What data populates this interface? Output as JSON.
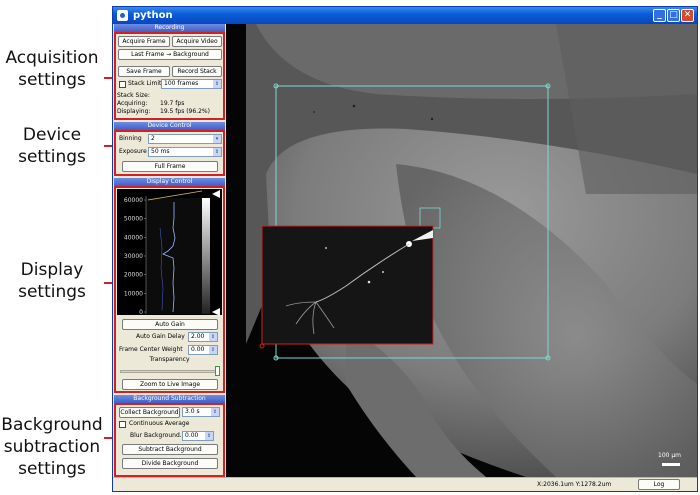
{
  "annotations": {
    "acquisition": "Acquisition settings",
    "device": "Device settings",
    "display": "Display settings",
    "background": "Background subtraction settings"
  },
  "window": {
    "title": "python"
  },
  "recording": {
    "title": "Recording",
    "acquire_frame": "Acquire Frame",
    "acquire_video": "Acquire Video",
    "last_frame_bg": "Last Frame → Background",
    "save_frame": "Save Frame",
    "record_stack": "Record Stack",
    "stack_limit_label": "Stack Limit",
    "stack_limit_value": "100 frames",
    "stack_size_label": "Stack Size:",
    "acquiring_label": "Acquiring:",
    "acquiring_value": "19.7 fps",
    "displaying_label": "Displaying:",
    "displaying_value": "19.5 fps   (96.2%)"
  },
  "device": {
    "title": "Device Control",
    "binning_label": "Binning",
    "binning_value": "2",
    "exposure_label": "Exposure",
    "exposure_value": "50 ms",
    "full_frame": "Full Frame"
  },
  "display": {
    "title": "Display Control",
    "histogram_ticks": [
      "60000",
      "50000",
      "40000",
      "30000",
      "20000",
      "10000",
      "0"
    ],
    "auto_gain": "Auto Gain",
    "auto_gain_delay_label": "Auto Gain Delay",
    "auto_gain_delay_value": "2.00",
    "frame_center_weight_label": "Frame Center Weight",
    "frame_center_weight_value": "0.00",
    "transparency_label": "Transparency",
    "zoom_live": "Zoom to Live Image"
  },
  "background": {
    "title": "Background Subtraction",
    "collect": "Collect Background",
    "collect_value": "3.0 s",
    "continuous_avg": "Continuous Average",
    "blur_label": "Blur Background.",
    "blur_value": "0.00",
    "subtract": "Subtract Background",
    "divide": "Divide Background"
  },
  "image": {
    "scale_bar_label": "100 μm"
  },
  "status": {
    "coords": "X:2036.1um Y:1278.2um",
    "log_button": "Log"
  },
  "colors": {
    "highlight": "#d42020",
    "roi": "#7fd8d0",
    "titlebar": "#0a5ed8"
  }
}
